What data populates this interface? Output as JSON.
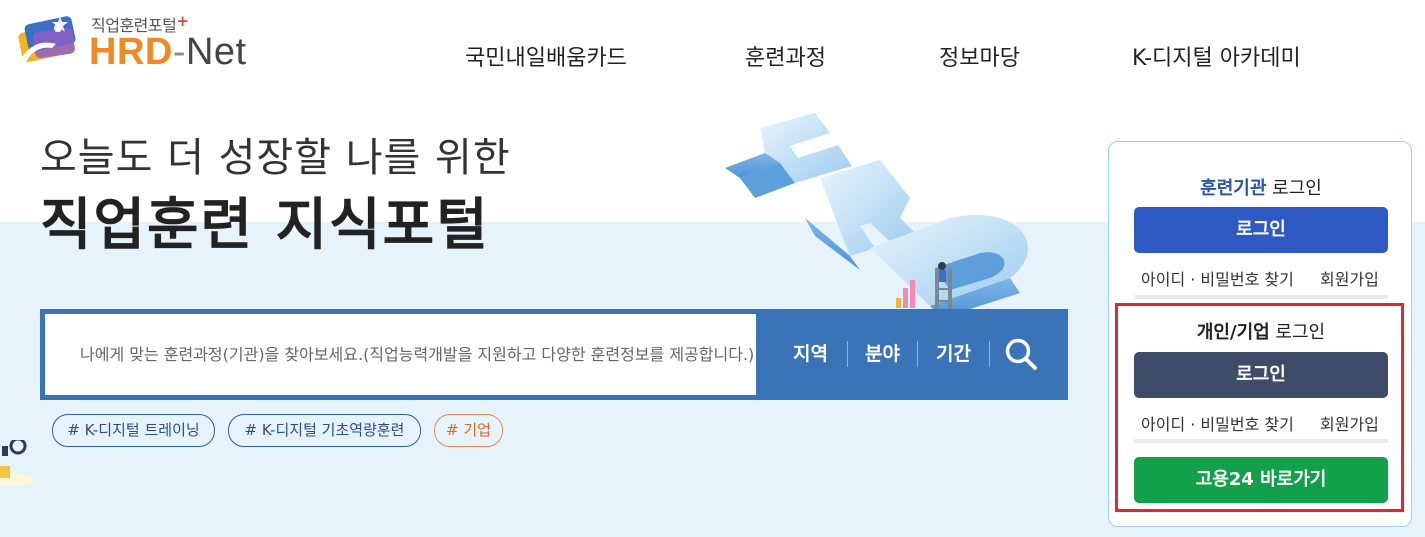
{
  "header": {
    "logo_sub": "직업훈련포털",
    "logo_hrd": "HRD",
    "logo_dash": "-",
    "logo_net": "Net",
    "nav": [
      "국민내일배움카드",
      "훈련과정",
      "정보마당",
      "K-디지털 아카데미"
    ]
  },
  "hero": {
    "line1": "오늘도 더 성장할 나를 위한",
    "line2": "직업훈련 지식포털"
  },
  "search": {
    "placeholder": "나에게 맞는 훈련과정(기관)을 찾아보세요.(직업능력개발을 지원하고 다양한 훈련정보를 제공합니다.)",
    "filters": [
      "지역",
      "분야",
      "기간"
    ],
    "button_icon": "search-icon"
  },
  "tags": [
    "# K-디지털 트레이닝",
    "# K-디지털 기초역량훈련",
    "# 기업"
  ],
  "login_panel": {
    "institution": {
      "title_strong": "훈련기관",
      "title_rest": " 로그인",
      "button": "로그인",
      "find": "아이디 · 비밀번호 찾기",
      "join": "회원가입"
    },
    "personal": {
      "title_strong": "개인/기업",
      "title_rest": " 로그인",
      "button": "로그인",
      "find": "아이디 · 비밀번호 찾기",
      "join": "회원가입"
    },
    "goyong24": "고용24 바로가기"
  },
  "colors": {
    "search_bg": "#3a73b6",
    "brand_orange": "#f08a24",
    "login_blue": "#2f59c2",
    "login_navy": "#3e4b69",
    "goyong_green": "#12a04a",
    "highlight_red": "#e0282e",
    "band_bg": "#e6f3fb"
  }
}
